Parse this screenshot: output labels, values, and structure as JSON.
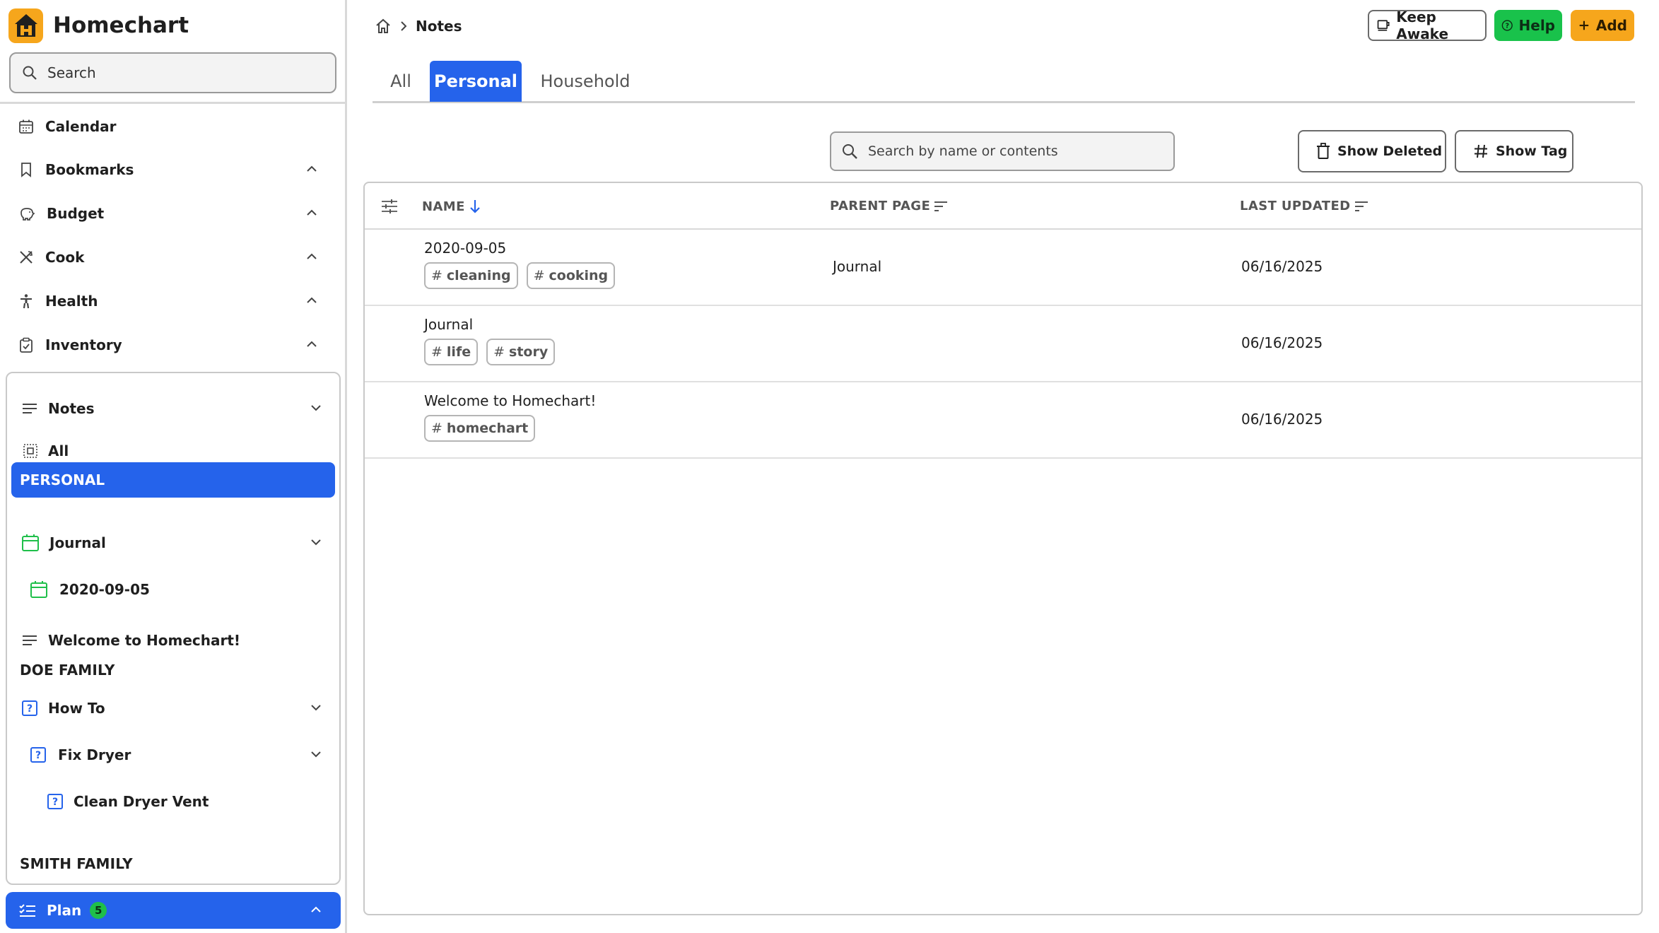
{
  "app": {
    "name": "Homechart"
  },
  "sidebar": {
    "search_placeholder": "Search",
    "items": [
      {
        "label": "Calendar",
        "icon": "calendar-icon"
      },
      {
        "label": "Bookmarks",
        "icon": "bookmark-icon"
      },
      {
        "label": "Budget",
        "icon": "piggy-bank-icon"
      },
      {
        "label": "Cook",
        "icon": "utensils-icon"
      },
      {
        "label": "Health",
        "icon": "person-icon"
      },
      {
        "label": "Inventory",
        "icon": "clipboard-icon"
      }
    ],
    "notes": {
      "label": "Notes",
      "all": "All",
      "personal_section": "PERSONAL",
      "journal": "Journal",
      "journal_child": "2020-09-05",
      "welcome": "Welcome to Homechart!",
      "doe_section": "DOE FAMILY",
      "how_to": "How To",
      "fix_dryer": "Fix Dryer",
      "clean_vent": "Clean Dryer Vent",
      "smith_section": "SMITH FAMILY"
    },
    "plan": {
      "label": "Plan",
      "badge": "5"
    }
  },
  "header": {
    "breadcrumb_current": "Notes",
    "keep_awake": "Keep Awake",
    "help": "Help",
    "add": "Add"
  },
  "tabs": [
    {
      "label": "All",
      "active": false
    },
    {
      "label": "Personal",
      "active": true
    },
    {
      "label": "Household",
      "active": false
    }
  ],
  "toolbar": {
    "search_placeholder": "Search by name or contents",
    "show_deleted": "Show Deleted",
    "show_tag": "Show Tag"
  },
  "table": {
    "columns": {
      "name": "NAME",
      "parent": "PARENT PAGE",
      "updated": "LAST UPDATED"
    },
    "rows": [
      {
        "name": "2020-09-05",
        "tags": [
          "cleaning",
          "cooking"
        ],
        "parent": "Journal",
        "updated": "06/16/2025"
      },
      {
        "name": "Journal",
        "tags": [
          "life",
          "story"
        ],
        "parent": "",
        "updated": "06/16/2025"
      },
      {
        "name": "Welcome to Homechart!",
        "tags": [
          "homechart"
        ],
        "parent": "",
        "updated": "06/16/2025"
      }
    ]
  },
  "colors": {
    "primary": "#2563eb",
    "brand": "#f6a61c",
    "help": "#19c24b",
    "journal_icon": "#1fbf4a"
  }
}
